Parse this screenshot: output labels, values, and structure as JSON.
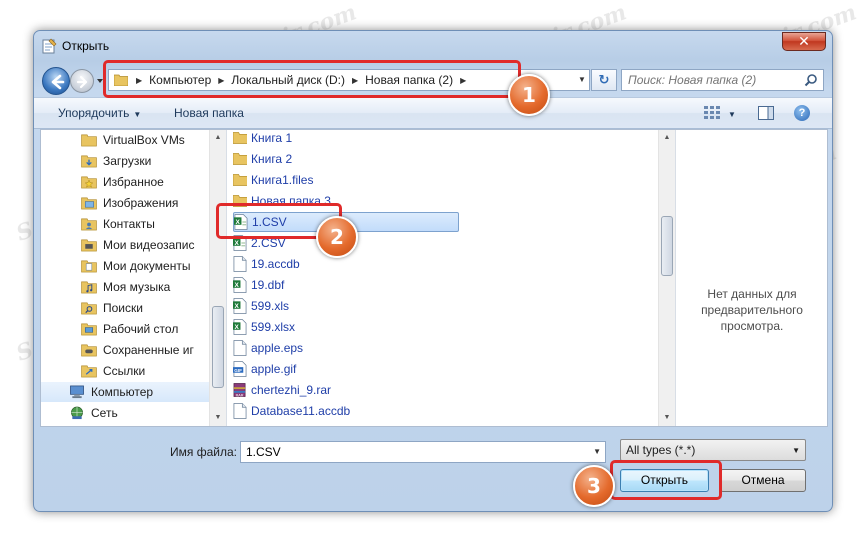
{
  "window": {
    "title": "Открыть",
    "close_label": "✕"
  },
  "address": {
    "crumbs": [
      "Компьютер",
      "Локальный диск (D:)",
      "Новая папка (2)"
    ]
  },
  "search": {
    "placeholder": "Поиск: Новая папка (2)"
  },
  "toolbar": {
    "organize_label": "Упорядочить",
    "new_folder_label": "Новая папка"
  },
  "nav": {
    "items": [
      {
        "label": "VirtualBox VMs",
        "icon": "folder-icon"
      },
      {
        "label": "Загрузки",
        "icon": "downloads-icon"
      },
      {
        "label": "Избранное",
        "icon": "favorites-icon"
      },
      {
        "label": "Изображения",
        "icon": "pictures-icon"
      },
      {
        "label": "Контакты",
        "icon": "contacts-icon"
      },
      {
        "label": "Мои видеозапис",
        "icon": "videos-icon"
      },
      {
        "label": "Мои документы",
        "icon": "documents-icon"
      },
      {
        "label": "Моя музыка",
        "icon": "music-icon"
      },
      {
        "label": "Поиски",
        "icon": "searches-icon"
      },
      {
        "label": "Рабочий стол",
        "icon": "desktop-icon"
      },
      {
        "label": "Сохраненные иг",
        "icon": "saved-games-icon"
      },
      {
        "label": "Ссылки",
        "icon": "links-icon"
      },
      {
        "label": "Компьютер",
        "icon": "computer-icon"
      },
      {
        "label": "Сеть",
        "icon": "network-icon"
      }
    ]
  },
  "files": {
    "items": [
      {
        "name": "Книга 1",
        "icon": "folder-icon"
      },
      {
        "name": "Книга 2",
        "icon": "folder-icon"
      },
      {
        "name": "Книга1.files",
        "icon": "folder-icon"
      },
      {
        "name": "Новая папка 3",
        "icon": "folder-icon"
      },
      {
        "name": "1.CSV",
        "icon": "excel-csv-icon"
      },
      {
        "name": "2.CSV",
        "icon": "excel-csv-icon"
      },
      {
        "name": "19.accdb",
        "icon": "generic-file-icon"
      },
      {
        "name": "19.dbf",
        "icon": "excel-file-icon"
      },
      {
        "name": "599.xls",
        "icon": "excel-file-icon"
      },
      {
        "name": "599.xlsx",
        "icon": "excel-file-icon"
      },
      {
        "name": "apple.eps",
        "icon": "generic-file-icon"
      },
      {
        "name": "apple.gif",
        "icon": "gif-image-icon"
      },
      {
        "name": "chertezhi_9.rar",
        "icon": "rar-archive-icon"
      },
      {
        "name": "Database11.accdb",
        "icon": "generic-file-icon"
      }
    ]
  },
  "preview": {
    "text": "Нет данных для\nпредварительного\nпросмотра."
  },
  "filename": {
    "label": "Имя файла:",
    "value": "1.CSV"
  },
  "filetype": {
    "value": "All types (*.*)"
  },
  "buttons": {
    "open_label": "Открыть",
    "cancel_label": "Отмена"
  },
  "callouts": [
    "1",
    "2",
    "3"
  ],
  "watermark": "Soringpcrepair.com",
  "colors": {
    "callout_red": "#e02a2a",
    "badge_orange": "#e46a2c",
    "link_blue": "#1f3ea8"
  }
}
